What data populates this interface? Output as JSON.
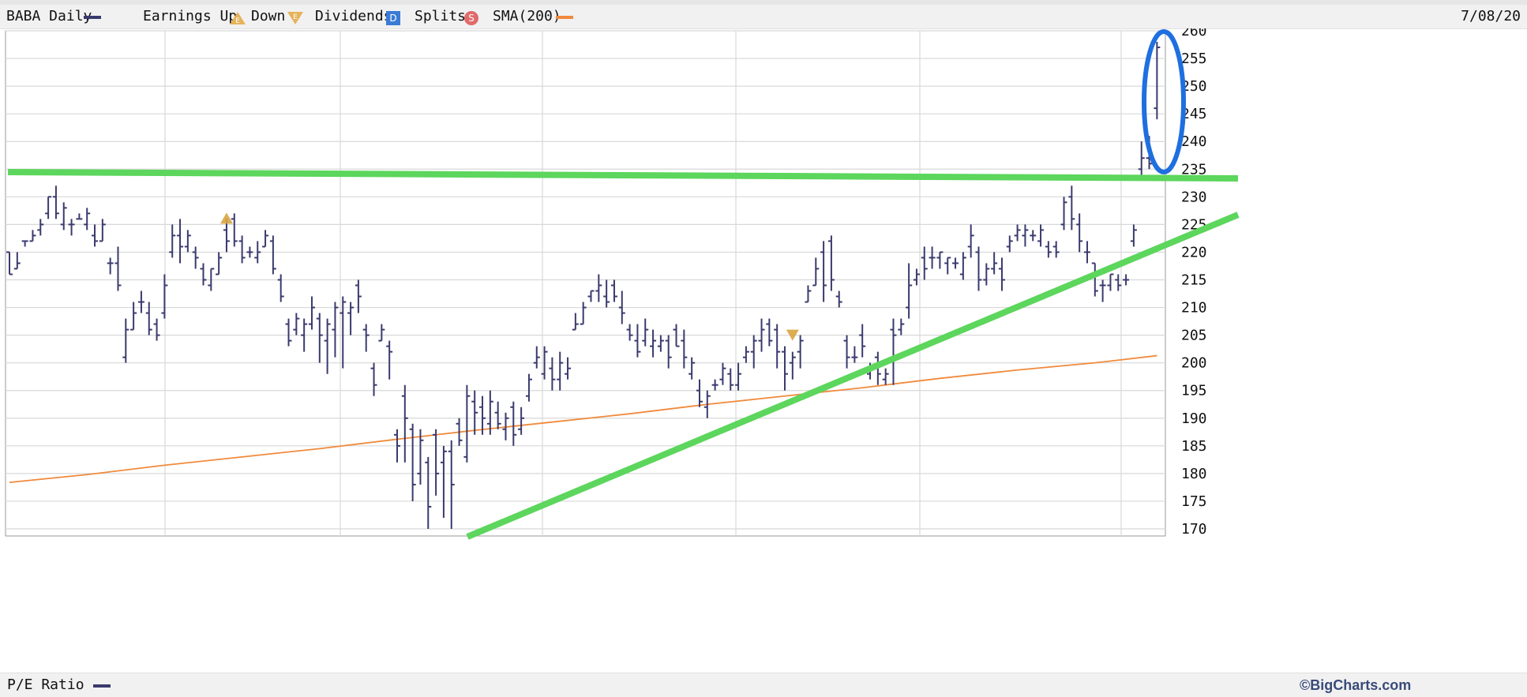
{
  "legend": {
    "symbol_label": "BABA Daily",
    "earnings_label": "Earnings Up",
    "down_label": "Down",
    "earnings_up_icon_text": "E",
    "earnings_down_icon_text": "E",
    "dividends_label": "Dividends",
    "dividends_icon_text": "D",
    "splits_label": "Splits",
    "splits_icon_text": "S",
    "sma_label": "SMA(200)",
    "date": "7/08/20"
  },
  "footer": {
    "pe_label": "P/E Ratio",
    "copyright": "©BigCharts.com"
  },
  "colors": {
    "price_bars": "#3a3a6e",
    "sma": "#f08a3c",
    "annotation_lines": "#5cd65c",
    "annotation_circle": "#1e6fe0",
    "earnings_marker": "#d9a441"
  },
  "chart_data": {
    "type": "ohlc",
    "ylim": [
      170,
      260
    ],
    "yticks": [
      "260",
      "255",
      "250",
      "245",
      "240",
      "235",
      "230",
      "225",
      "220",
      "215",
      "210",
      "205",
      "200",
      "195",
      "190",
      "185",
      "180",
      "175",
      "170"
    ],
    "bars": [
      [
        0,
        220,
        216,
        220,
        216
      ],
      [
        1,
        220,
        217,
        217,
        218
      ],
      [
        2,
        222,
        221,
        222,
        222
      ],
      [
        3,
        224,
        222,
        222,
        223
      ],
      [
        4,
        226,
        223,
        224,
        225
      ],
      [
        5,
        230,
        226,
        227,
        230
      ],
      [
        6,
        232,
        226,
        230,
        227
      ],
      [
        7,
        229,
        224,
        225,
        228
      ],
      [
        8,
        226,
        223,
        225,
        225
      ],
      [
        9,
        227,
        226,
        226,
        226
      ],
      [
        10,
        228,
        224,
        225,
        227
      ],
      [
        11,
        225,
        221,
        223,
        222
      ],
      [
        12,
        226,
        222,
        222,
        225
      ],
      [
        13,
        219,
        216,
        218,
        218
      ],
      [
        14,
        221,
        213,
        218,
        214
      ],
      [
        15,
        208,
        200,
        201,
        206
      ],
      [
        16,
        211,
        206,
        206,
        209
      ],
      [
        17,
        213,
        209,
        211,
        211
      ],
      [
        18,
        211,
        205,
        209,
        206
      ],
      [
        19,
        208,
        204,
        207,
        205
      ],
      [
        20,
        216,
        208,
        209,
        214
      ],
      [
        21,
        225,
        219,
        220,
        223
      ],
      [
        22,
        226,
        218,
        223,
        221
      ],
      [
        23,
        224,
        220,
        221,
        223
      ],
      [
        24,
        221,
        217,
        220,
        219
      ],
      [
        25,
        218,
        214,
        217,
        215
      ],
      [
        26,
        217,
        213,
        214,
        217
      ],
      [
        27,
        220,
        216,
        216,
        219
      ],
      [
        28,
        226,
        220,
        224,
        222
      ],
      [
        29,
        227,
        221,
        226,
        222
      ],
      [
        30,
        223,
        218,
        222,
        219
      ],
      [
        31,
        221,
        219,
        220,
        220
      ],
      [
        32,
        222,
        218,
        219,
        220
      ],
      [
        33,
        224,
        221,
        221,
        223
      ],
      [
        34,
        223,
        216,
        222,
        217
      ],
      [
        35,
        216,
        211,
        215,
        212
      ],
      [
        36,
        208,
        203,
        207,
        204
      ],
      [
        37,
        209,
        205,
        206,
        208
      ],
      [
        38,
        208,
        202,
        205,
        207
      ],
      [
        39,
        212,
        206,
        207,
        210
      ],
      [
        40,
        209,
        200,
        208,
        205
      ],
      [
        41,
        208,
        198,
        204,
        207
      ],
      [
        42,
        211,
        201,
        206,
        210
      ],
      [
        43,
        212,
        199,
        209,
        211
      ],
      [
        44,
        211,
        205,
        209,
        210
      ],
      [
        45,
        215,
        209,
        214,
        212
      ],
      [
        46,
        207,
        202,
        206,
        205
      ],
      [
        47,
        200,
        194,
        199,
        196
      ],
      [
        48,
        207,
        204,
        204,
        206
      ],
      [
        49,
        204,
        197,
        203,
        202
      ],
      [
        50,
        188,
        182,
        187,
        185
      ],
      [
        51,
        196,
        182,
        194,
        190
      ],
      [
        52,
        189,
        175,
        188,
        178
      ],
      [
        53,
        188,
        178,
        180,
        186
      ],
      [
        54,
        183,
        170,
        182,
        174
      ],
      [
        55,
        188,
        176,
        187,
        180
      ],
      [
        56,
        185,
        172,
        182,
        184
      ],
      [
        57,
        186,
        170,
        184,
        178
      ],
      [
        58,
        190,
        185,
        189,
        186
      ],
      [
        59,
        196,
        182,
        183,
        194
      ],
      [
        60,
        195,
        187,
        193,
        191
      ],
      [
        61,
        194,
        187,
        192,
        190
      ],
      [
        62,
        195,
        187,
        189,
        193
      ],
      [
        63,
        193,
        188,
        191,
        189
      ],
      [
        64,
        191,
        186,
        188,
        190
      ],
      [
        65,
        193,
        185,
        192,
        187
      ],
      [
        66,
        192,
        187,
        188,
        190
      ],
      [
        67,
        198,
        193,
        194,
        197
      ],
      [
        68,
        203,
        199,
        200,
        201
      ],
      [
        69,
        203,
        197,
        198,
        202
      ],
      [
        70,
        201,
        195,
        199,
        197
      ],
      [
        71,
        202,
        195,
        197,
        200
      ],
      [
        72,
        201,
        197,
        198,
        199
      ],
      [
        73,
        209,
        206,
        206,
        207
      ],
      [
        74,
        211,
        207,
        207,
        210
      ],
      [
        75,
        213,
        211,
        212,
        213
      ],
      [
        76,
        216,
        211,
        213,
        214
      ],
      [
        77,
        215,
        210,
        212,
        211
      ],
      [
        78,
        215,
        211,
        214,
        212
      ],
      [
        79,
        213,
        207,
        210,
        209
      ],
      [
        80,
        207,
        204,
        206,
        205
      ],
      [
        81,
        207,
        201,
        204,
        202
      ],
      [
        82,
        208,
        203,
        204,
        206
      ],
      [
        83,
        206,
        201,
        203,
        204
      ],
      [
        84,
        205,
        202,
        203,
        204
      ],
      [
        85,
        205,
        199,
        204,
        201
      ],
      [
        86,
        207,
        203,
        206,
        203
      ],
      [
        87,
        206,
        199,
        204,
        201
      ],
      [
        88,
        201,
        197,
        198,
        200
      ],
      [
        89,
        197,
        192,
        195,
        193
      ],
      [
        90,
        195,
        190,
        192,
        194
      ],
      [
        91,
        197,
        195,
        196,
        196
      ],
      [
        92,
        200,
        196,
        197,
        199
      ],
      [
        93,
        199,
        195,
        198,
        196
      ],
      [
        94,
        200,
        195,
        196,
        198
      ],
      [
        95,
        203,
        200,
        201,
        202
      ],
      [
        96,
        205,
        199,
        202,
        204
      ],
      [
        97,
        208,
        202,
        204,
        206
      ],
      [
        98,
        208,
        203,
        207,
        204
      ],
      [
        99,
        207,
        199,
        206,
        202
      ],
      [
        100,
        203,
        195,
        202,
        198
      ],
      [
        101,
        202,
        197,
        200,
        201
      ],
      [
        102,
        205,
        199,
        202,
        204
      ],
      [
        103,
        214,
        211,
        211,
        213
      ],
      [
        104,
        219,
        214,
        214,
        217
      ],
      [
        105,
        222,
        211,
        220,
        214
      ],
      [
        106,
        223,
        213,
        222,
        215
      ],
      [
        107,
        213,
        210,
        212,
        211
      ],
      [
        108,
        205,
        199,
        204,
        201
      ],
      [
        109,
        203,
        200,
        201,
        201
      ],
      [
        110,
        207,
        201,
        205,
        203
      ],
      [
        111,
        200,
        197,
        198,
        199
      ],
      [
        112,
        202,
        196,
        201,
        198
      ],
      [
        113,
        199,
        196,
        197,
        198
      ],
      [
        114,
        208,
        196,
        206,
        205
      ],
      [
        115,
        208,
        205,
        206,
        207
      ],
      [
        116,
        218,
        208,
        210,
        214
      ],
      [
        117,
        217,
        214,
        215,
        216
      ],
      [
        118,
        221,
        215,
        219,
        217
      ],
      [
        119,
        221,
        217,
        219,
        219
      ],
      [
        120,
        220,
        217,
        219,
        220
      ],
      [
        121,
        219,
        216,
        218,
        219
      ],
      [
        122,
        219,
        217,
        218,
        218
      ],
      [
        123,
        220,
        215,
        216,
        219
      ],
      [
        124,
        225,
        219,
        221,
        223
      ],
      [
        125,
        221,
        213,
        220,
        215
      ],
      [
        126,
        218,
        214,
        215,
        217
      ],
      [
        127,
        220,
        216,
        217,
        218
      ],
      [
        128,
        219,
        213,
        217,
        215
      ],
      [
        129,
        223,
        220,
        221,
        222
      ],
      [
        130,
        225,
        222,
        223,
        224
      ],
      [
        131,
        225,
        221,
        223,
        224
      ],
      [
        132,
        224,
        222,
        223,
        223
      ],
      [
        133,
        225,
        221,
        222,
        224
      ],
      [
        134,
        222,
        219,
        221,
        220
      ],
      [
        135,
        222,
        219,
        221,
        220
      ],
      [
        136,
        230,
        224,
        225,
        229
      ],
      [
        137,
        232,
        224,
        230,
        226
      ],
      [
        138,
        227,
        220,
        225,
        222
      ],
      [
        139,
        222,
        218,
        220,
        220
      ],
      [
        140,
        218,
        212,
        218,
        213
      ],
      [
        141,
        215,
        211,
        214,
        214
      ],
      [
        142,
        216,
        213,
        214,
        216
      ],
      [
        143,
        216,
        213,
        215,
        214
      ],
      [
        144,
        216,
        214,
        215,
        215
      ],
      [
        145,
        225,
        221,
        222,
        224
      ],
      [
        146,
        240,
        233,
        235,
        237
      ],
      [
        147,
        241,
        235,
        237,
        236
      ],
      [
        148,
        258,
        244,
        246,
        257
      ]
    ],
    "sma200": [
      [
        0,
        178.4
      ],
      [
        10,
        179.8
      ],
      [
        20,
        181.5
      ],
      [
        30,
        183.0
      ],
      [
        40,
        184.5
      ],
      [
        50,
        186.2
      ],
      [
        60,
        187.8
      ],
      [
        70,
        189.3
      ],
      [
        80,
        190.8
      ],
      [
        90,
        192.5
      ],
      [
        100,
        194.0
      ],
      [
        110,
        195.5
      ],
      [
        120,
        197.2
      ],
      [
        130,
        198.7
      ],
      [
        140,
        200.0
      ],
      [
        148,
        201.3
      ]
    ],
    "earnings_markers": [
      [
        28,
        "up",
        226
      ],
      [
        101,
        "down",
        205
      ]
    ]
  }
}
